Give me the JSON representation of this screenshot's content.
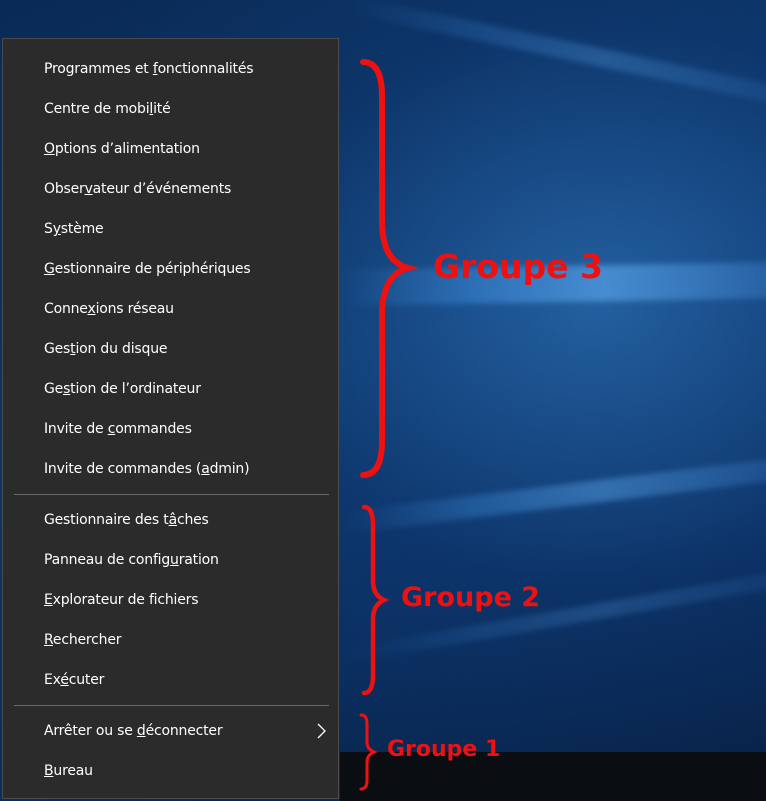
{
  "menu": {
    "items": [
      {
        "before": "Programmes et ",
        "key": "f",
        "after": "onctionnalités"
      },
      {
        "before": "Centre de mobi",
        "key": "l",
        "after": "ité"
      },
      {
        "before": "",
        "key": "O",
        "after": "ptions d’alimentation"
      },
      {
        "before": "Obser",
        "key": "v",
        "after": "ateur d’événements"
      },
      {
        "before": "S",
        "key": "y",
        "after": "stème"
      },
      {
        "before": "",
        "key": "G",
        "after": "estionnaire de périphériques"
      },
      {
        "before": "Conne",
        "key": "x",
        "after": "ions réseau"
      },
      {
        "before": "Ges",
        "key": "t",
        "after": "ion du disque"
      },
      {
        "before": "Ge",
        "key": "s",
        "after": "tion de l’ordinateur"
      },
      {
        "before": "Invite de ",
        "key": "c",
        "after": "ommandes"
      },
      {
        "before": "Invite de commandes (",
        "key": "a",
        "after": "dmin)"
      },
      {
        "before": "Gestionnaire des t",
        "key": "â",
        "after": "ches"
      },
      {
        "before": "Panneau de config",
        "key": "u",
        "after": "ration"
      },
      {
        "before": "",
        "key": "E",
        "after": "xplorateur de fichiers"
      },
      {
        "before": "",
        "key": "R",
        "after": "echercher"
      },
      {
        "before": "Ex",
        "key": "é",
        "after": "cuter"
      },
      {
        "before": "Arrêter ou se ",
        "key": "d",
        "after": "éconnecter"
      },
      {
        "before": "",
        "key": "B",
        "after": "ureau"
      }
    ],
    "submenu_icon": "chevron-right-icon"
  },
  "annotations": {
    "group3": "Groupe 3",
    "group2": "Groupe 2",
    "group1": "Groupe 1",
    "color": "#ee1111"
  },
  "colors": {
    "menu_bg": "#2b2b2b",
    "menu_text": "#ffffff",
    "separator": "#6a6a6a",
    "desktop_bg": "#0b2c55"
  }
}
